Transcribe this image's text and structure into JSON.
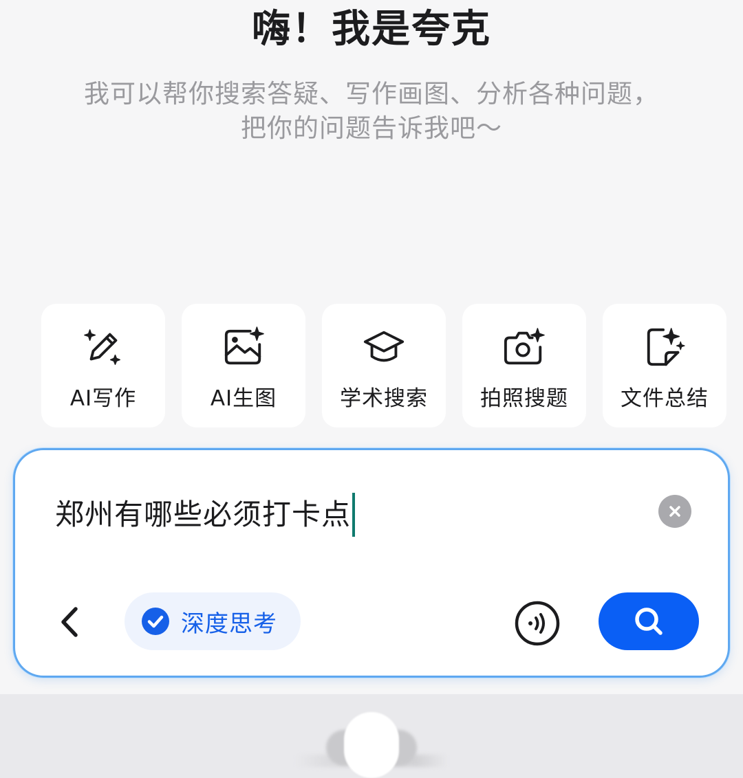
{
  "header": {
    "greeting": "嗨！我是夸克",
    "subtitle_line1": "我可以帮你搜索答疑、写作画图、分析各种问题，",
    "subtitle_line2": "把你的问题告诉我吧～"
  },
  "tools": [
    {
      "label": "AI写作",
      "icon": "pencil-sparkle-icon"
    },
    {
      "label": "AI生图",
      "icon": "image-sparkle-icon"
    },
    {
      "label": "学术搜索",
      "icon": "graduation-cap-icon"
    },
    {
      "label": "拍照搜题",
      "icon": "camera-sparkle-icon"
    },
    {
      "label": "文件总结",
      "icon": "document-sparkle-icon"
    }
  ],
  "search": {
    "query": "郑州有哪些必须打卡点",
    "deep_think_label": "深度思考",
    "deep_think_checked": true
  },
  "colors": {
    "accent": "#0a5ff5",
    "chip_bg": "#eef3fd",
    "border": "#5fa8f0",
    "caret": "#0f7a6e"
  }
}
